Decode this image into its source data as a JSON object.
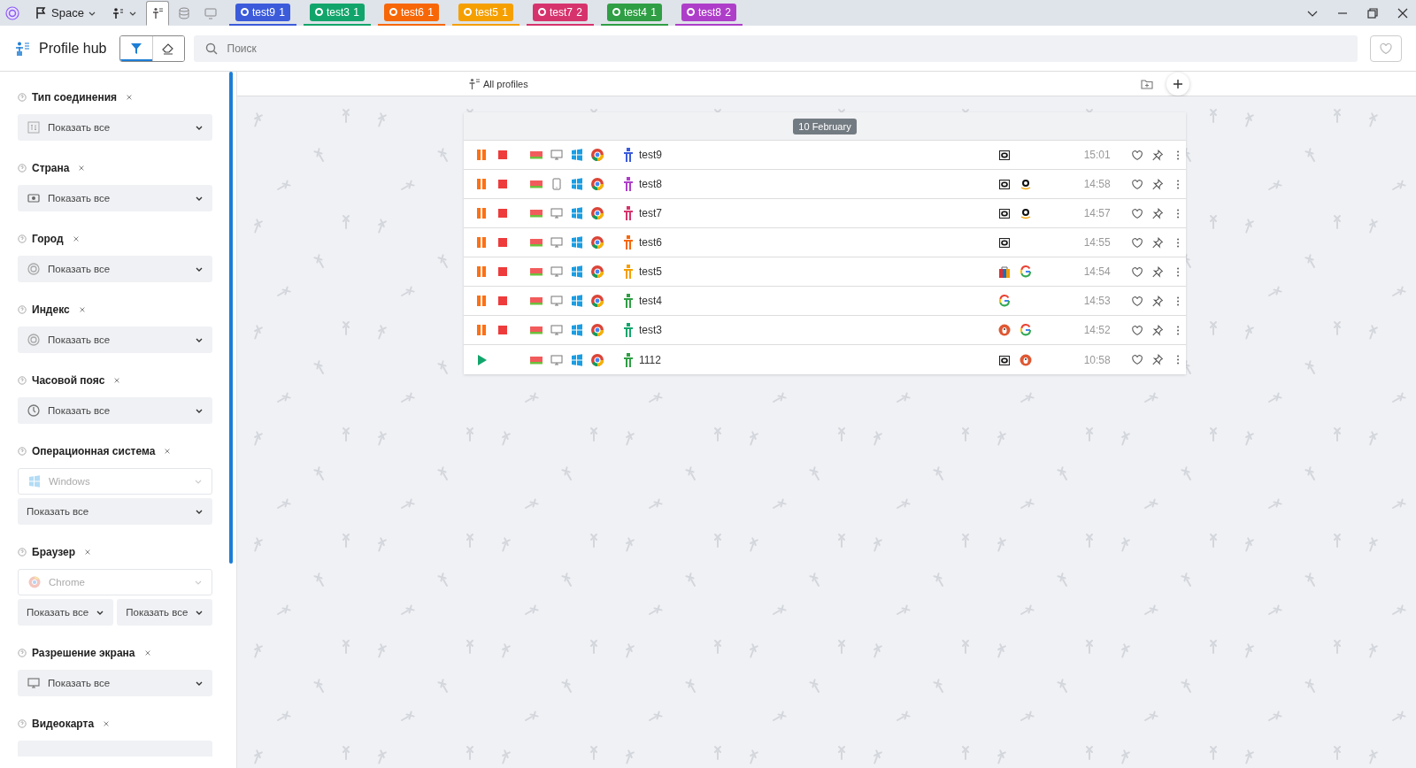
{
  "topbar": {
    "space": "Space",
    "view_tabs": [
      {
        "selected": true
      },
      {
        "selected": false
      },
      {
        "selected": false
      }
    ],
    "profile_tabs": [
      {
        "label": "test9",
        "count": "1",
        "color": "#3b5bdb"
      },
      {
        "label": "test3",
        "count": "1",
        "color": "#12a56b"
      },
      {
        "label": "test6",
        "count": "1",
        "color": "#f76707"
      },
      {
        "label": "test5",
        "count": "1",
        "color": "#f59f00"
      },
      {
        "label": "test7",
        "count": "2",
        "color": "#d6336c"
      },
      {
        "label": "test4",
        "count": "1",
        "color": "#2f9e44"
      },
      {
        "label": "test8",
        "count": "2",
        "color": "#ae3ec9"
      }
    ]
  },
  "header": {
    "title": "Profile hub",
    "filter_on": true,
    "search": {
      "placeholder": "Поиск"
    }
  },
  "filters": [
    {
      "kind": "select",
      "title": "Тип соединения",
      "selects": [
        "Показать все"
      ]
    },
    {
      "kind": "select",
      "title": "Страна",
      "selects": [
        "Показать все"
      ]
    },
    {
      "kind": "select",
      "title": "Город",
      "selects": [
        "Показать все"
      ]
    },
    {
      "kind": "select",
      "title": "Индекс",
      "selects": [
        "Показать все"
      ]
    },
    {
      "kind": "select",
      "title": "Часовой пояс",
      "selects": [
        "Показать все"
      ]
    },
    {
      "kind": "preset",
      "title": "Операционная система",
      "preset": "Windows",
      "selects": [
        "Показать все"
      ]
    },
    {
      "kind": "preset",
      "title": "Браузер",
      "preset": "Chrome",
      "selects": [
        "Показать все",
        "Показать все"
      ]
    },
    {
      "kind": "select",
      "title": "Разрешение экрана",
      "selects": [
        "Показать все"
      ]
    },
    {
      "kind": "cut",
      "title": "Видеокарта"
    }
  ],
  "list": {
    "heading": "All profiles",
    "date": "10 February",
    "rows": [
      {
        "name": "test9",
        "color": "#3b5bdb",
        "running": true,
        "device": {
          "kind": "desktop"
        },
        "sites": [
          {
            "kind": "camera"
          }
        ],
        "time": "15:01"
      },
      {
        "name": "test8",
        "color": "#ae3ec9",
        "running": true,
        "device": {
          "kind": "tablet"
        },
        "sites": [
          {
            "kind": "camera"
          },
          {
            "kind": "amazon"
          }
        ],
        "time": "14:58"
      },
      {
        "name": "test7",
        "color": "#d6336c",
        "running": true,
        "device": {
          "kind": "desktop"
        },
        "sites": [
          {
            "kind": "camera"
          },
          {
            "kind": "amazon"
          }
        ],
        "time": "14:57"
      },
      {
        "name": "test6",
        "color": "#f76707",
        "running": true,
        "device": {
          "kind": "desktop"
        },
        "sites": [
          {
            "kind": "camera"
          }
        ],
        "time": "14:55"
      },
      {
        "name": "test5",
        "color": "#f59f00",
        "running": true,
        "device": {
          "kind": "desktop"
        },
        "sites": [
          {
            "kind": "shop"
          },
          {
            "kind": "google"
          }
        ],
        "time": "14:54"
      },
      {
        "name": "test4",
        "color": "#2f9e44",
        "running": true,
        "device": {
          "kind": "desktop"
        },
        "sites": [
          {
            "kind": "google"
          }
        ],
        "time": "14:53"
      },
      {
        "name": "test3",
        "color": "#12a56b",
        "running": true,
        "device": {
          "kind": "desktop"
        },
        "sites": [
          {
            "kind": "duck"
          },
          {
            "kind": "google"
          }
        ],
        "time": "14:52"
      },
      {
        "name": "1112",
        "color": "#2f9e44",
        "running": false,
        "device": {
          "kind": "desktop"
        },
        "sites": [
          {
            "kind": "camera"
          },
          {
            "kind": "duck"
          }
        ],
        "time": "10:58"
      }
    ]
  }
}
